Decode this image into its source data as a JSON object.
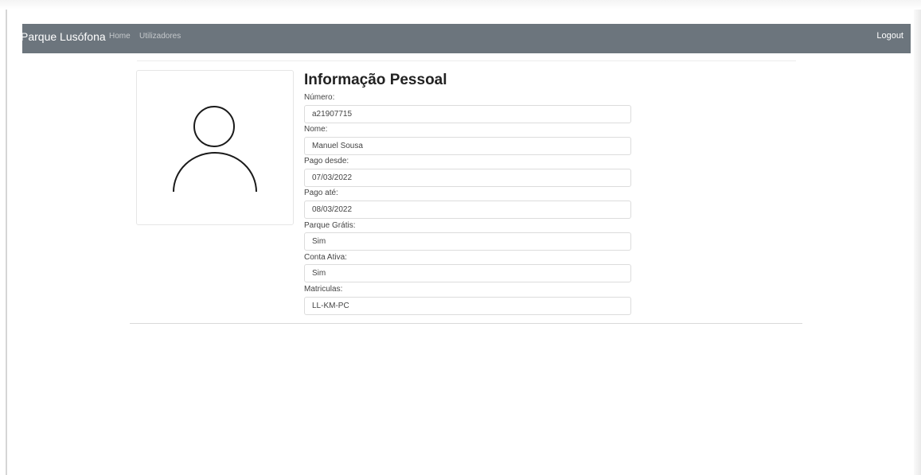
{
  "navbar": {
    "brand": "Parque Lusófona",
    "links": [
      "Home",
      "Utilizadores"
    ],
    "logout": "Logout",
    "background": "#6c757d"
  },
  "profile": {
    "avatar_icon": "user-icon",
    "title": "Informação Pessoal",
    "fields": [
      {
        "label": "Número:",
        "value": "a21907715"
      },
      {
        "label": "Nome:",
        "value": "Manuel Sousa"
      },
      {
        "label": "Pago desde:",
        "value": "07/03/2022"
      },
      {
        "label": "Pago até:",
        "value": "08/03/2022"
      },
      {
        "label": "Parque Grátis:",
        "value": "Sim"
      },
      {
        "label": "Conta Ativa:",
        "value": "Sim"
      },
      {
        "label": "Matriculas:",
        "value": "LL-KM-PC"
      }
    ]
  }
}
